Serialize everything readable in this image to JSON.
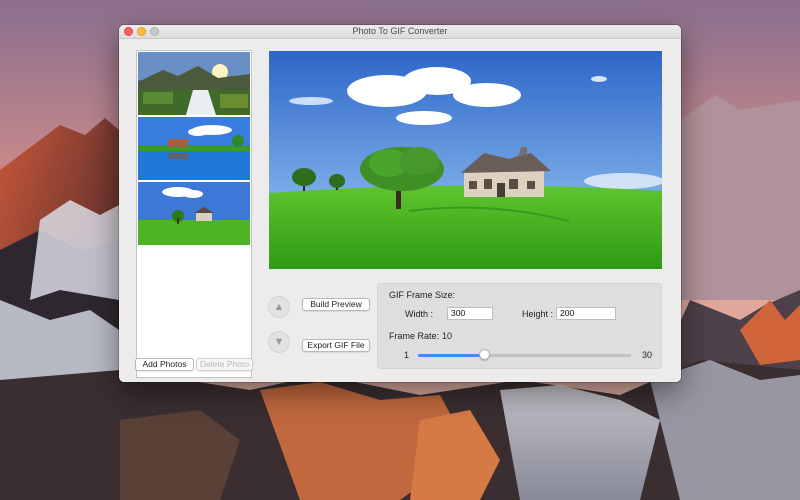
{
  "window": {
    "title": "Photo To GIF Converter"
  },
  "photo_list": {
    "thumbnails": [
      {
        "name": "waterfall-sunset"
      },
      {
        "name": "lake-house-reflection"
      },
      {
        "name": "green-field-house"
      }
    ],
    "add_label": "Add  Photos",
    "delete_label": "Delete Photo"
  },
  "controls": {
    "up_icon": "▲",
    "down_icon": "▼",
    "build_label": "Build Preview",
    "export_label": "Export GIF File"
  },
  "settings": {
    "frame_size_label": "GIF Frame Size:",
    "width_label": "Width :",
    "width_value": "300",
    "height_label": "Height :",
    "height_value": "200",
    "frame_rate_label": "Frame Rate:",
    "frame_rate_value": "10",
    "slider_min": "1",
    "slider_max": "30",
    "slider_fraction": 0.31
  },
  "colors": {
    "slider_accent": "#3d8cf0",
    "close": "#fc605c",
    "minimize": "#fdbc40"
  }
}
